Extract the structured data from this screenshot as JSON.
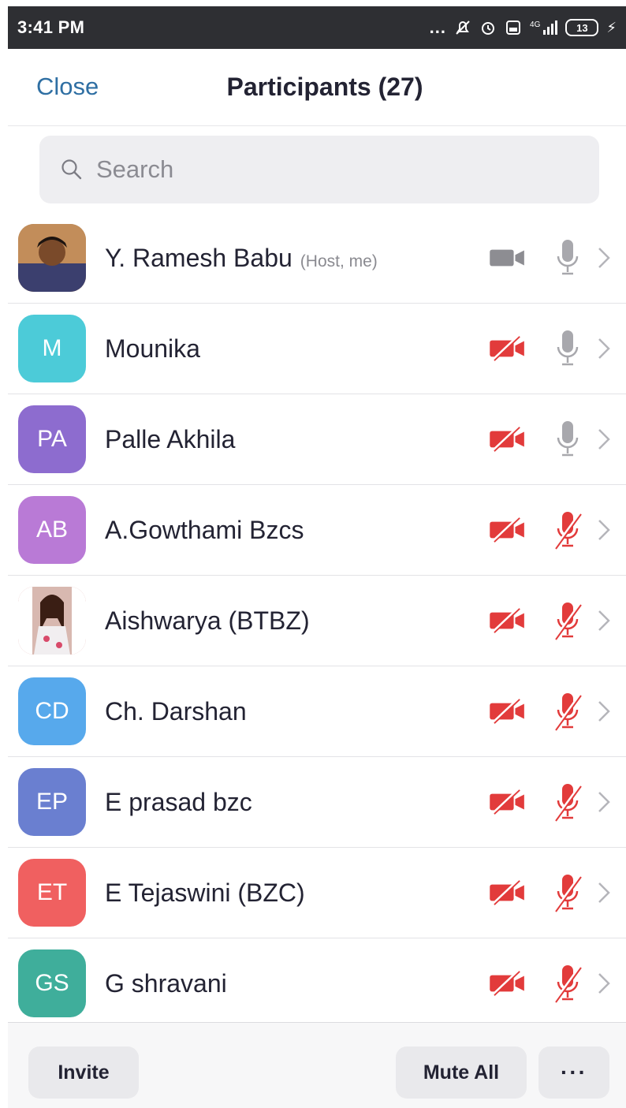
{
  "status_bar": {
    "time": "3:41 PM",
    "icons": [
      "more-dots-icon",
      "mute-bell-icon",
      "alarm-icon",
      "data-saver-icon",
      "signal-icon",
      "battery-icon"
    ],
    "dots": "...",
    "signal_label": "4G",
    "battery": "13"
  },
  "header": {
    "close_label": "Close",
    "title": "Participants (27)"
  },
  "search": {
    "placeholder": "Search"
  },
  "colors": {
    "status_bg": "#2e2f33",
    "link_blue": "#2f6fa3",
    "muted_red": "#e23b3b",
    "icon_gray": "#9a9a9f"
  },
  "participants": [
    {
      "name": "Y. Ramesh Babu",
      "role": "(Host, me)",
      "initials": "",
      "avatar": "photo",
      "color": "#9b6b3a",
      "video": "on",
      "audio": "on"
    },
    {
      "name": "Mounika",
      "role": "",
      "initials": "M",
      "avatar": "initials",
      "color": "#4ccbd8",
      "video": "off",
      "audio": "on"
    },
    {
      "name": "Palle Akhila",
      "role": "",
      "initials": "PA",
      "avatar": "initials",
      "color": "#8d6ccf",
      "video": "off",
      "audio": "on"
    },
    {
      "name": "A.Gowthami Bzcs",
      "role": "",
      "initials": "AB",
      "avatar": "initials",
      "color": "#b97ad6",
      "video": "off",
      "audio": "muted"
    },
    {
      "name": "Aishwarya (BTBZ)",
      "role": "",
      "initials": "",
      "avatar": "photo",
      "color": "#c97575",
      "video": "off",
      "audio": "muted"
    },
    {
      "name": "Ch. Darshan",
      "role": "",
      "initials": "CD",
      "avatar": "initials",
      "color": "#57a9ec",
      "video": "off",
      "audio": "muted"
    },
    {
      "name": "E prasad bzc",
      "role": "",
      "initials": "EP",
      "avatar": "initials",
      "color": "#6a7fd0",
      "video": "off",
      "audio": "muted"
    },
    {
      "name": "E Tejaswini (BZC)",
      "role": "",
      "initials": "ET",
      "avatar": "initials",
      "color": "#f06060",
      "video": "off",
      "audio": "muted"
    },
    {
      "name": "G shravani",
      "role": "",
      "initials": "GS",
      "avatar": "initials",
      "color": "#3fae9b",
      "video": "off",
      "audio": "muted"
    }
  ],
  "footer": {
    "invite_label": "Invite",
    "mute_all_label": "Mute All",
    "more_label": "···"
  }
}
